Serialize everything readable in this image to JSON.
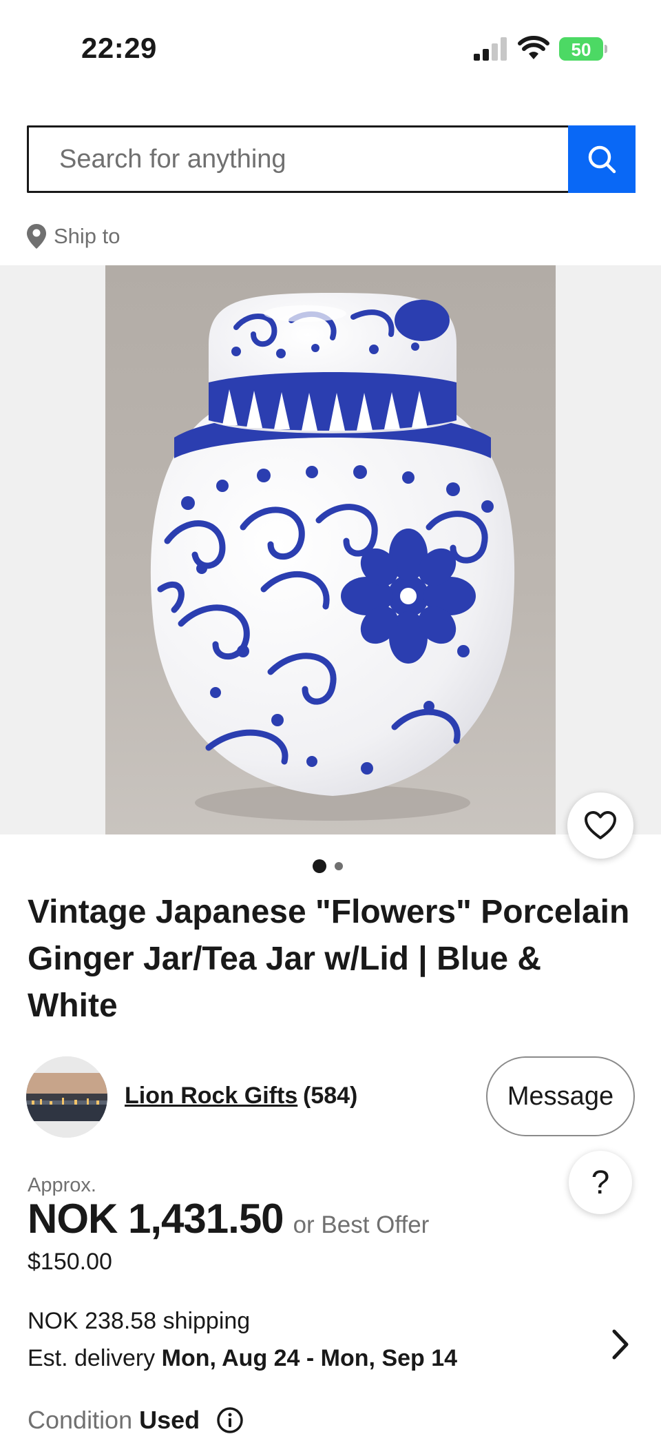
{
  "status_bar": {
    "time": "22:29",
    "battery_level": "50",
    "icons": [
      "signal-icon",
      "wifi-icon",
      "battery-charging-icon"
    ]
  },
  "search": {
    "placeholder": "Search for anything",
    "button_icon": "search-icon"
  },
  "ship_to": {
    "icon": "location-pin-icon",
    "label": "Ship to"
  },
  "gallery": {
    "image_subject": "blue and white porcelain ginger jar",
    "total_images": 2,
    "current_index": 1,
    "watch_icon": "heart-icon"
  },
  "listing": {
    "title": "Vintage Japanese \"Flowers\" Porcelain Ginger Jar/Tea Jar w/Lid | Blue & White"
  },
  "seller": {
    "name": "Lion Rock Gifts",
    "feedback_count": "(584)",
    "message_label": "Message"
  },
  "help": {
    "label": "?"
  },
  "price": {
    "approx_label": "Approx.",
    "amount": "NOK 1,431.50",
    "best_offer": "or Best Offer",
    "original": "$150.00"
  },
  "shipping": {
    "cost": "NOK 238.58 shipping",
    "delivery_prefix": "Est. delivery ",
    "delivery_dates": "Mon, Aug 24 - Mon, Sep 14",
    "chevron_icon": "chevron-right-icon"
  },
  "condition": {
    "label": "Condition",
    "value": "Used",
    "icon": "info-icon"
  },
  "colors": {
    "accent_blue": "#0968f6",
    "text_primary": "#191919",
    "text_secondary": "#707070",
    "battery_green": "#4cd964"
  }
}
